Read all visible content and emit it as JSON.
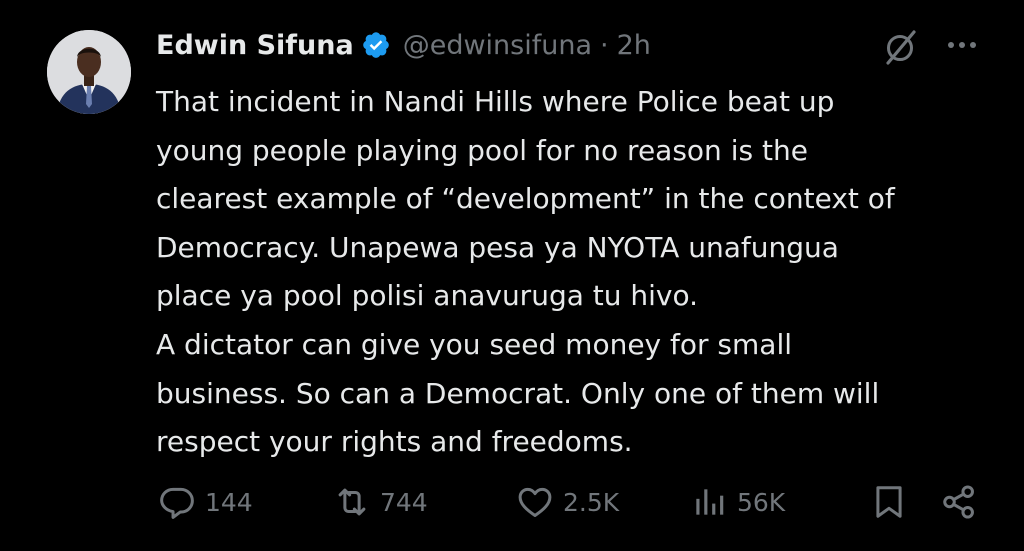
{
  "tweet": {
    "author": {
      "name": "Edwin Sifuna",
      "handle": "@edwinsifuna",
      "verified": true,
      "avatar": "avatar-photo-man-in-suit"
    },
    "separator": "·",
    "time": "2h",
    "text_lines": [
      "That incident in Nandi Hills where Police beat up",
      "young people playing pool for no reason is the",
      "clearest example of “development” in the context of",
      "Democracy. Unapewa pesa ya NYOTA unafungua",
      "place ya pool polisi anavuruga tu hivo.",
      "A dictator can give you seed money for small",
      "business. So can a Democrat. Only one of them will",
      "respect your rights and freedoms."
    ],
    "actions": {
      "reply_count": "144",
      "retweet_count": "744",
      "like_count": "2.5K",
      "views_count": "56K"
    }
  },
  "icons": {
    "verified": "verified-badge-icon",
    "grok": "grok-icon",
    "more": "more-icon",
    "reply": "reply-icon",
    "retweet": "retweet-icon",
    "like": "like-icon",
    "views": "views-icon",
    "bookmark": "bookmark-icon",
    "share": "share-icon"
  },
  "colors": {
    "background": "#000000",
    "text": "#e7e9ea",
    "secondary": "#71767b",
    "verified": "#1d9bf0"
  }
}
